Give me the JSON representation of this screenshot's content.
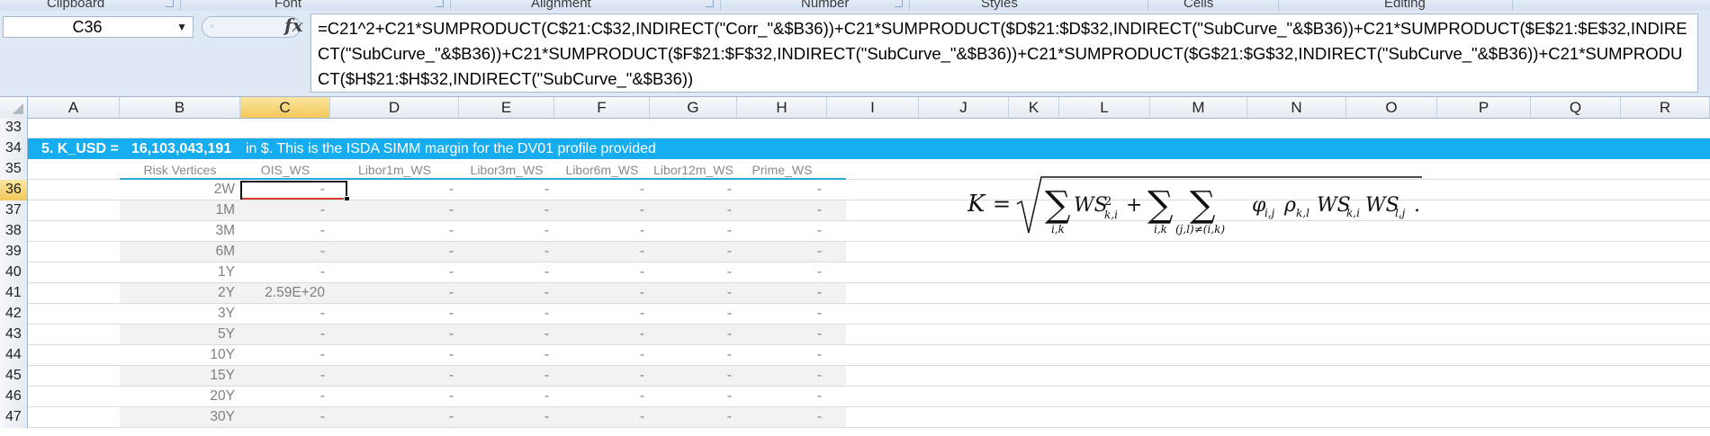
{
  "ribbon": {
    "groups": [
      "Clipboard",
      "Font",
      "Alignment",
      "Number",
      "Styles",
      "Cells",
      "Editing"
    ]
  },
  "formula_bar": {
    "name_box": "C36",
    "fx_symbol": "fx",
    "formula": "=C21^2+C21*SUMPRODUCT(C$21:C$32,INDIRECT(\"Corr_\"&$B36))+C21*SUMPRODUCT($D$21:$D$32,INDIRECT(\"SubCurve_\"&$B36))+C21*SUMPRODUCT($E$21:$E$32,INDIRECT(\"SubCurve_\"&$B36))+C21*SUMPRODUCT($F$21:$F$32,INDIRECT(\"SubCurve_\"&$B36))+C21*SUMPRODUCT($G$21:$G$32,INDIRECT(\"SubCurve_\"&$B36))+C21*SUMPRODUCT($H$21:$H$32,INDIRECT(\"SubCurve_\"&$B36))"
  },
  "columns": [
    "A",
    "B",
    "C",
    "D",
    "E",
    "F",
    "G",
    "H",
    "I",
    "J",
    "K",
    "L",
    "M",
    "N",
    "O",
    "P",
    "Q",
    "R"
  ],
  "selected_column": "C",
  "selected_row": "36",
  "rows": [
    "33",
    "34",
    "35",
    "36",
    "37",
    "38",
    "39",
    "40",
    "41",
    "42",
    "43",
    "44",
    "45",
    "46",
    "47"
  ],
  "summary_row": {
    "label": "5. K_USD =",
    "value": "16,103,043,191",
    "note": "in $. This is the ISDA SIMM margin for the DV01 profile provided",
    "band_color": "#15adf0"
  },
  "table": {
    "headers": [
      "Risk Vertices",
      "OIS_WS",
      "Libor1m_WS",
      "Libor3m_WS",
      "Libor6m_WS",
      "Libor12m_WS",
      "Prime_WS"
    ],
    "rows": [
      [
        "2W",
        "-",
        "-",
        "-",
        "-",
        "-",
        "-"
      ],
      [
        "1M",
        "-",
        "-",
        "-",
        "-",
        "-",
        "-"
      ],
      [
        "3M",
        "-",
        "-",
        "-",
        "-",
        "-",
        "-"
      ],
      [
        "6M",
        "-",
        "-",
        "-",
        "-",
        "-",
        "-"
      ],
      [
        "1Y",
        "-",
        "-",
        "-",
        "-",
        "-",
        "-"
      ],
      [
        "2Y",
        "2.59E+20",
        "-",
        "-",
        "-",
        "-",
        "-"
      ],
      [
        "3Y",
        "-",
        "-",
        "-",
        "-",
        "-",
        "-"
      ],
      [
        "5Y",
        "-",
        "-",
        "-",
        "-",
        "-",
        "-"
      ],
      [
        "10Y",
        "-",
        "-",
        "-",
        "-",
        "-",
        "-"
      ],
      [
        "15Y",
        "-",
        "-",
        "-",
        "-",
        "-",
        "-"
      ],
      [
        "20Y",
        "-",
        "-",
        "-",
        "-",
        "-",
        "-"
      ],
      [
        "30Y",
        "-",
        "-",
        "-",
        "-",
        "-",
        "-"
      ]
    ]
  },
  "formula_image": {
    "lhs": "K",
    "equals": "=",
    "term1": "WS",
    "sub_ki": "k,i",
    "sup2": "2",
    "sum_under_1": "i,k",
    "plus": "+",
    "sum_under_2": "i,k",
    "sum_under_3": "(j,l)≠(i,k)",
    "phi": "φ",
    "phi_sub": "i,j",
    "rho": "ρ",
    "rho_sub": "k,l",
    "ws_a_sub": "k,i",
    "ws_b_sub": "l,j",
    "period": "."
  }
}
